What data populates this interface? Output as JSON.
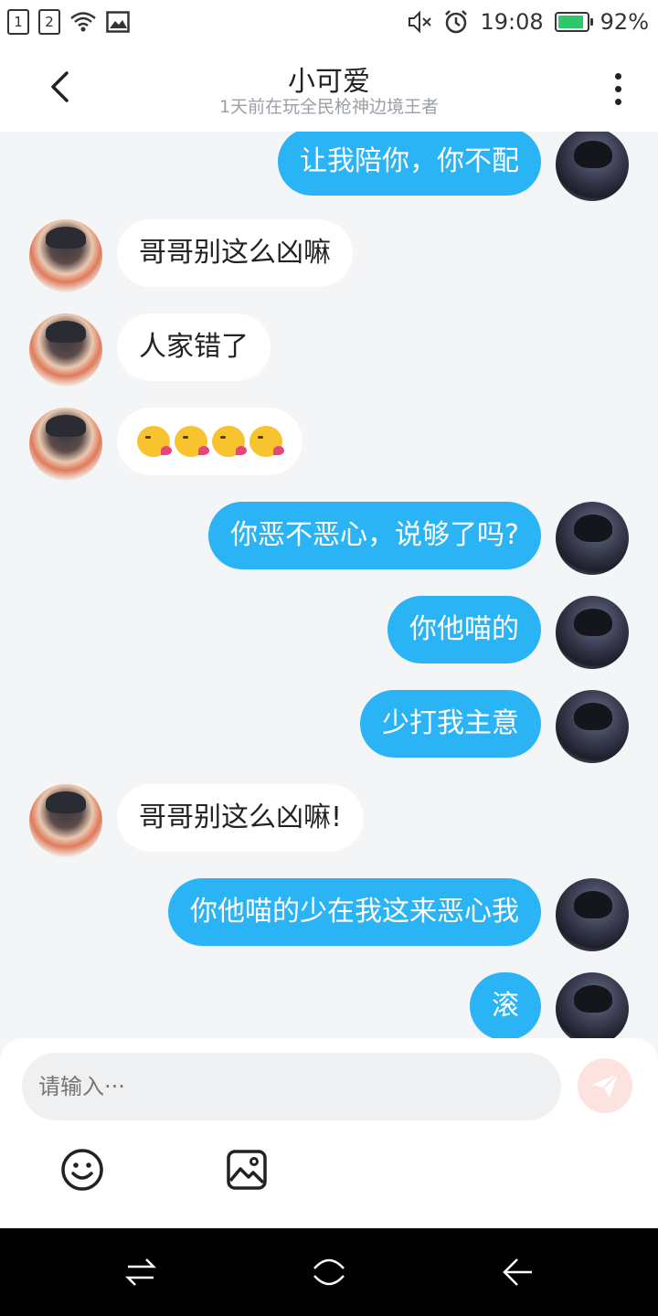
{
  "status_bar": {
    "sim1": "1",
    "sim2": "2",
    "time": "19:08",
    "battery": "92%",
    "battery_level": 0.92,
    "icons": [
      "wifi-icon",
      "image-icon",
      "mute-icon",
      "alarm-icon",
      "battery-icon"
    ]
  },
  "header": {
    "title": "小可爱",
    "subtitle": "1天前在玩全民枪神边境王者"
  },
  "messages": [
    {
      "side": "mine",
      "text": "让我陪你，你不配"
    },
    {
      "side": "other",
      "text": "哥哥别这么凶嘛"
    },
    {
      "side": "other",
      "text": "人家错了"
    },
    {
      "side": "other",
      "emoji": "kissing-face",
      "count": 4
    },
    {
      "side": "mine",
      "text": "你恶不恶心，说够了吗?"
    },
    {
      "side": "mine",
      "text": "你他喵的"
    },
    {
      "side": "mine",
      "text": "少打我主意"
    },
    {
      "side": "other",
      "text": "哥哥别这么凶嘛!"
    },
    {
      "side": "mine",
      "text": "你他喵的少在我这来恶心我"
    },
    {
      "side": "mine",
      "text": "滚"
    }
  ],
  "composer": {
    "placeholder": "请输入···"
  },
  "colors": {
    "mine_bubble": "#2ab4f5",
    "other_bubble": "#ffffff",
    "background": "#f4f5f7"
  }
}
